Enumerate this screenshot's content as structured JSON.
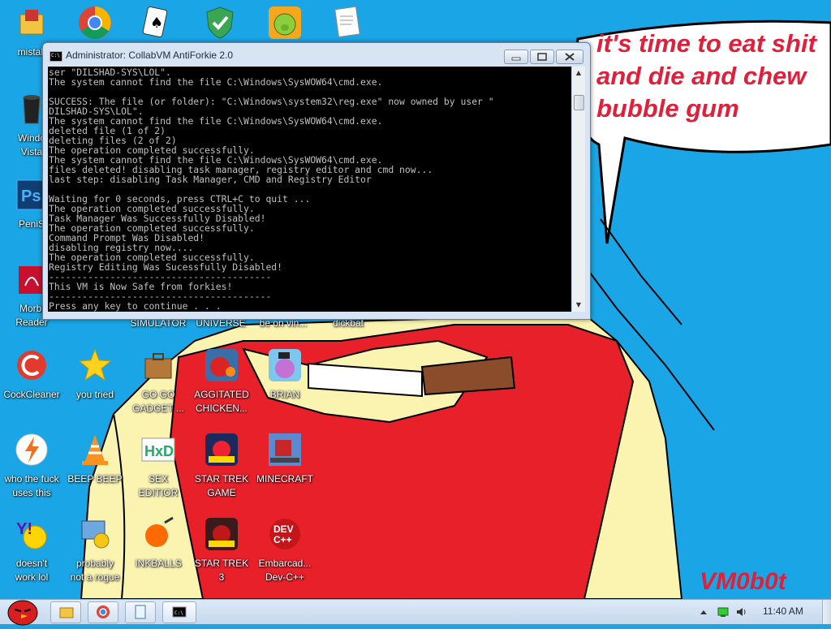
{
  "desktop": {
    "bubble_text": "it's time to eat shit\nand die and chew\nbubble gum",
    "signature": "VM0b0t",
    "icons": [
      {
        "label": "mistak",
        "icon": "folder-app-icon"
      },
      {
        "label": "",
        "icon": "chrome-icon"
      },
      {
        "label": "",
        "icon": "cards-game-icon"
      },
      {
        "label": "",
        "icon": "shield-check-icon"
      },
      {
        "label": "",
        "icon": "angry-birds-pig-icon"
      },
      {
        "label": "",
        "icon": "document-icon"
      },
      {
        "label": "Windo\nVista",
        "icon": "recycle-bin-icon"
      },
      {
        "label": "PeniS",
        "icon": "photoshop-icon"
      },
      {
        "label": "Morbi\nReader",
        "icon": "pdf-reader-icon"
      },
      {
        "label": "SIMULATOR",
        "icon": "app-icon"
      },
      {
        "label": "UNIVERSE",
        "icon": "app-icon"
      },
      {
        "label": "be on vin...",
        "icon": "app-icon"
      },
      {
        "label": "dickbat",
        "icon": "app-icon"
      },
      {
        "label": "CockCleaner",
        "icon": "ccleaner-icon"
      },
      {
        "label": "you tried",
        "icon": "gold-star-icon"
      },
      {
        "label": "GO GO\nGADGET ...",
        "icon": "briefcase-icon"
      },
      {
        "label": "AGGITATED\nCHICKEN...",
        "icon": "angry-birds-icon"
      },
      {
        "label": "BRIAN",
        "icon": "angry-birds-icon"
      },
      {
        "label": "who the fuck\nuses this",
        "icon": "avast-icon"
      },
      {
        "label": "BEEP BEEP",
        "icon": "vlc-cone-icon"
      },
      {
        "label": "SEX\nEDITIOR",
        "icon": "hxd-icon"
      },
      {
        "label": "STAR TREK\nGAME",
        "icon": "star-wars-birds-icon"
      },
      {
        "label": "MINECRAFT",
        "icon": "minecraft-icon"
      },
      {
        "label": "doesn't\nwork lol",
        "icon": "yahoo-messenger-icon"
      },
      {
        "label": "probably\nnot a rogue",
        "icon": "settings-monitor-icon"
      },
      {
        "label": "INKBALLS",
        "icon": "inkball-icon"
      },
      {
        "label": "STAR TREK\n3",
        "icon": "star-wars-birds-icon"
      },
      {
        "label": "Embarcad...\nDev-C++",
        "icon": "devcpp-icon"
      }
    ]
  },
  "window": {
    "title": "Administrator:  CollabVM AntiForkie 2.0",
    "console_lines": [
      "ser \"DILSHAD-SYS\\LOL\".",
      "The system cannot find the file C:\\Windows\\SysWOW64\\cmd.exe.",
      "",
      "SUCCESS: The file (or folder): \"C:\\Windows\\system32\\reg.exe\" now owned by user \"",
      "DILSHAD-SYS\\LOL\".",
      "The system cannot find the file C:\\Windows\\SysWOW64\\cmd.exe.",
      "deleted file (1 of 2)",
      "deleting files (2 of 2)",
      "The operation completed successfully.",
      "The system cannot find the file C:\\Windows\\SysWOW64\\cmd.exe.",
      "files deleted! disabling task manager, registry editor and cmd now...",
      "last step: disabling Task Manager, CMD and Registry Editor",
      "",
      "Waiting for 0 seconds, press CTRL+C to quit ...",
      "The operation completed successfully.",
      "Task Manager Was Successfully Disabled!",
      "The operation completed successfully.",
      "Command Prompt Was Disabled!",
      "disabling registry now....",
      "The operation completed successfully.",
      "Registry Editing Was Sucessfully Disabled!",
      "----------------------------------------",
      "This VM is Now Safe from forkies!",
      "----------------------------------------",
      "Press any key to continue . . ."
    ]
  },
  "taskbar": {
    "clock": "11:40 AM",
    "buttons": [
      "explorer-icon",
      "chrome-icon",
      "notepad-icon",
      "cmd-icon"
    ],
    "tray": [
      "arrow-up-icon",
      "network-icon",
      "volume-icon"
    ]
  },
  "colors": {
    "wallpaper": "#1aa6e6",
    "text_red": "#e0203a",
    "skin": "#fbf3b0",
    "shirt": "#e8202a"
  }
}
